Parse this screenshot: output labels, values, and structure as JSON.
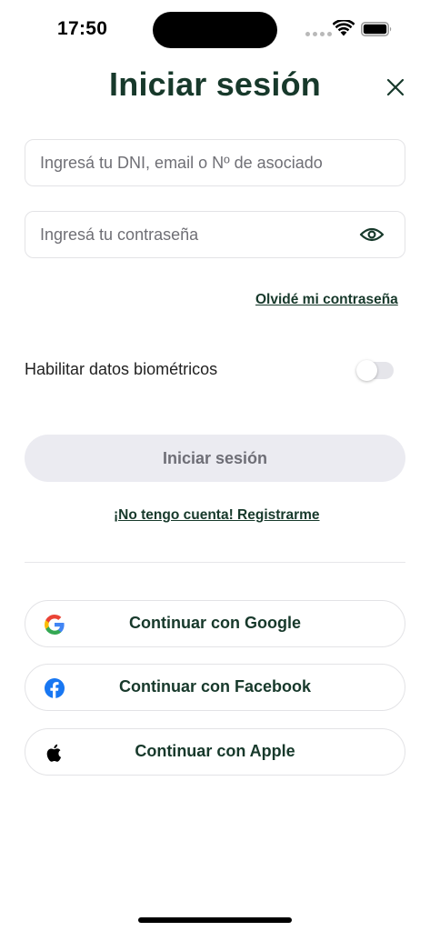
{
  "status_bar": {
    "time": "17:50"
  },
  "header": {
    "title": "Iniciar sesión"
  },
  "form": {
    "user_placeholder": "Ingresá tu DNI, email o Nº de asociado",
    "user_value": "",
    "password_placeholder": "Ingresá tu contraseña",
    "password_value": "",
    "forgot_password": "Olvidé mi contraseña",
    "biometrics_label": "Habilitar datos biométricos",
    "biometrics_enabled": false,
    "submit_label": "Iniciar sesión",
    "register_link": "¡No tengo cuenta! Registrarme"
  },
  "social": {
    "google_label": "Continuar con Google",
    "facebook_label": "Continuar con Facebook",
    "apple_label": "Continuar con Apple"
  },
  "colors": {
    "brand_dark_green": "#17392b",
    "disabled_button_bg": "#ebebf1",
    "facebook_blue": "#1877f2"
  },
  "icons": [
    "wifi-icon",
    "battery-icon",
    "close-icon",
    "eye-icon",
    "google-icon",
    "facebook-icon",
    "apple-icon"
  ]
}
